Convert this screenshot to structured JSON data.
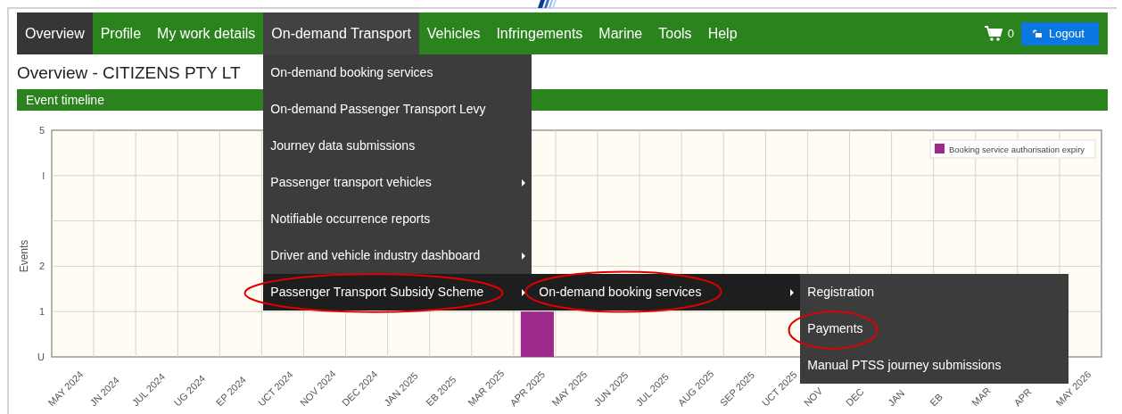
{
  "nav": {
    "items": [
      {
        "label": "Overview",
        "selected": true,
        "open": false
      },
      {
        "label": "Profile",
        "selected": false,
        "open": false
      },
      {
        "label": "My work details",
        "selected": false,
        "open": false
      },
      {
        "label": "On-demand Transport",
        "selected": false,
        "open": true,
        "menu": [
          {
            "label": "On-demand booking services",
            "has_submenu": false,
            "active": false,
            "circled": false
          },
          {
            "label": "On-demand Passenger Transport Levy",
            "has_submenu": false,
            "active": false,
            "circled": false
          },
          {
            "label": "Journey data submissions",
            "has_submenu": false,
            "active": false,
            "circled": false
          },
          {
            "label": "Passenger transport vehicles",
            "has_submenu": true,
            "active": false,
            "circled": false
          },
          {
            "label": "Notifiable occurrence reports",
            "has_submenu": false,
            "active": false,
            "circled": false
          },
          {
            "label": "Driver and vehicle industry dashboard",
            "has_submenu": true,
            "active": false,
            "circled": false
          },
          {
            "label": "Passenger Transport Subsidy Scheme",
            "has_submenu": true,
            "active": true,
            "circled": true,
            "submenu": [
              {
                "label": "On-demand booking services",
                "has_submenu": true,
                "active": true,
                "circled": true,
                "submenu": [
                  {
                    "label": "Registration",
                    "circled": false
                  },
                  {
                    "label": "Payments",
                    "circled": true
                  },
                  {
                    "label": "Manual PTSS journey submissions",
                    "circled": false
                  }
                ]
              }
            ]
          }
        ]
      },
      {
        "label": "Vehicles",
        "selected": false,
        "open": false
      },
      {
        "label": "Infringements",
        "selected": false,
        "open": false
      },
      {
        "label": "Marine",
        "selected": false,
        "open": false
      },
      {
        "label": "Tools",
        "selected": false,
        "open": false
      },
      {
        "label": "Help",
        "selected": false,
        "open": false
      }
    ],
    "cart_count": "0",
    "logout": "Logout"
  },
  "title": "Overview - CITIZENS PTY LT",
  "panel": {
    "title": "Event timeline",
    "chart_data": {
      "type": "bar",
      "ylabel": "Events",
      "grid": true,
      "categories": [
        "MAY 2024",
        "JN 2024",
        "JUL 2024",
        "UG 2024",
        "EP 2024",
        "UCT 2024",
        "NOV 2024",
        "DEC 2024",
        "JAN 2025",
        "EB 2025",
        "MAR 2025",
        "APR 2025",
        "MAY 2025",
        "JUN 2025",
        "JUL 2025",
        "AUG 2025",
        "SEP 2025",
        "UCT 2025",
        "NOV",
        "DEC",
        "JAN",
        "EB",
        "MAR",
        "APR",
        "MAY 2026"
      ],
      "series": [
        {
          "name": "Booking service authorisation expiry",
          "color": "#9c2a8c",
          "values": [
            0,
            0,
            0,
            0,
            0,
            0,
            0,
            0,
            0,
            0,
            0,
            1,
            0,
            0,
            0,
            0,
            0,
            0,
            0,
            0,
            0,
            0,
            0,
            0,
            0
          ]
        }
      ],
      "ylim": [
        0,
        5
      ],
      "yticks": [
        {
          "value": 0,
          "label": "U"
        },
        {
          "value": 1,
          "label": "1"
        },
        {
          "value": 2,
          "label": "2"
        },
        {
          "value": 4,
          "label": "l"
        },
        {
          "value": 5,
          "label": "5"
        }
      ]
    }
  }
}
